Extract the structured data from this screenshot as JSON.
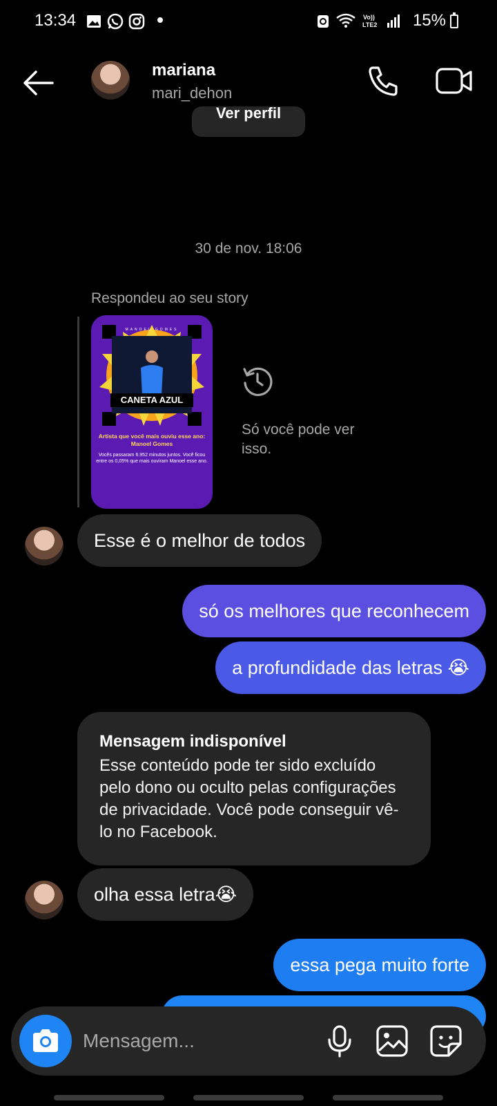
{
  "status_bar": {
    "time": "13:34",
    "battery": "15%",
    "left_icons": [
      "gallery-icon",
      "whatsapp-icon",
      "instagram-icon"
    ],
    "right_icons": [
      "recycle-icon",
      "wifi-icon",
      "volte-icon",
      "signal-icon",
      "battery-icon"
    ]
  },
  "header": {
    "name": "mariana",
    "handle": "mari_dehon",
    "profile_button": "Ver perfil"
  },
  "timestamp": "30 de nov. 18:06",
  "story_reply": {
    "label": "Respondeu ao seu story",
    "story": {
      "artist_wordmark": "MANOEL GOMES",
      "song": "CANETA AZUL",
      "line1": "Artista que você mais ouviu esse ano: Manoel Gomes",
      "line2": "Vocês passaram 6.952 minutos juntos. Você ficou entre os 0,05% que mais ouviram Manoel esse ano."
    },
    "notice": "Só você pode ver isso."
  },
  "messages": [
    {
      "from": "them",
      "text": "Esse é o melhor de todos"
    },
    {
      "from": "me",
      "text": "só os melhores que reconhecem"
    },
    {
      "from": "me",
      "text": "a profundidade das letras 😭"
    },
    {
      "from": "them",
      "title": "Mensagem indisponível",
      "text": "Esse conteúdo pode ter sido excluído pelo dono ou oculto pelas configurações de privacidade. Você pode conseguir vê-lo no Facebook."
    },
    {
      "from": "them",
      "text": "olha essa letra😭"
    },
    {
      "from": "me",
      "text": "essa pega muito forte"
    },
    {
      "from": "me",
      "text": ""
    }
  ],
  "composer": {
    "placeholder": "Mensagem...",
    "icons": [
      "camera-icon",
      "microphone-icon",
      "gallery-icon",
      "sticker-icon"
    ]
  },
  "colors": {
    "background": "#000000",
    "incoming_bubble": "#262626",
    "outgoing_purple": "#5a4fe0",
    "outgoing_blue": "#1f7df2",
    "muted_text": "#a8a8a8"
  }
}
